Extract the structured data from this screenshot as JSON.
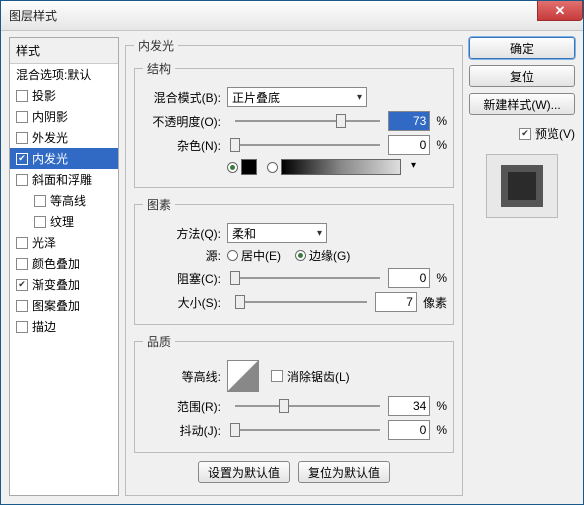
{
  "window": {
    "title": "图层样式"
  },
  "sidebar": {
    "header": "样式",
    "blend_defaults": "混合选项:默认",
    "items": [
      {
        "label": "投影",
        "checked": false,
        "selected": false
      },
      {
        "label": "内阴影",
        "checked": false,
        "selected": false
      },
      {
        "label": "外发光",
        "checked": false,
        "selected": false
      },
      {
        "label": "内发光",
        "checked": true,
        "selected": true
      },
      {
        "label": "斜面和浮雕",
        "checked": false,
        "selected": false
      },
      {
        "label": "等高线",
        "checked": false,
        "selected": false,
        "sub": true
      },
      {
        "label": "纹理",
        "checked": false,
        "selected": false,
        "sub": true
      },
      {
        "label": "光泽",
        "checked": false,
        "selected": false
      },
      {
        "label": "颜色叠加",
        "checked": false,
        "selected": false
      },
      {
        "label": "渐变叠加",
        "checked": true,
        "selected": false
      },
      {
        "label": "图案叠加",
        "checked": false,
        "selected": false
      },
      {
        "label": "描边",
        "checked": false,
        "selected": false
      }
    ]
  },
  "panel": {
    "title": "内发光",
    "structure": {
      "legend": "结构",
      "blend_mode_label": "混合模式(B):",
      "blend_mode_value": "正片叠底",
      "opacity_label": "不透明度(O):",
      "opacity_value": "73",
      "opacity_suffix": "%",
      "noise_label": "杂色(N):",
      "noise_value": "0",
      "noise_suffix": "%",
      "color_hex": "#000000"
    },
    "elements": {
      "legend": "图素",
      "method_label": "方法(Q):",
      "method_value": "柔和",
      "source_label": "源:",
      "source_center": "居中(E)",
      "source_edge": "边缘(G)",
      "source_selected": "edge",
      "choke_label": "阻塞(C):",
      "choke_value": "0",
      "choke_suffix": "%",
      "size_label": "大小(S):",
      "size_value": "7",
      "size_suffix": "像素"
    },
    "quality": {
      "legend": "品质",
      "contour_label": "等高线:",
      "antialias_label": "消除锯齿(L)",
      "antialias_checked": false,
      "range_label": "范围(R):",
      "range_value": "34",
      "range_suffix": "%",
      "jitter_label": "抖动(J):",
      "jitter_value": "0",
      "jitter_suffix": "%"
    },
    "footer": {
      "set_default": "设置为默认值",
      "reset_default": "复位为默认值"
    }
  },
  "rightcol": {
    "ok": "确定",
    "cancel": "复位",
    "new_style": "新建样式(W)...",
    "preview_label": "预览(V)",
    "preview_checked": true
  }
}
